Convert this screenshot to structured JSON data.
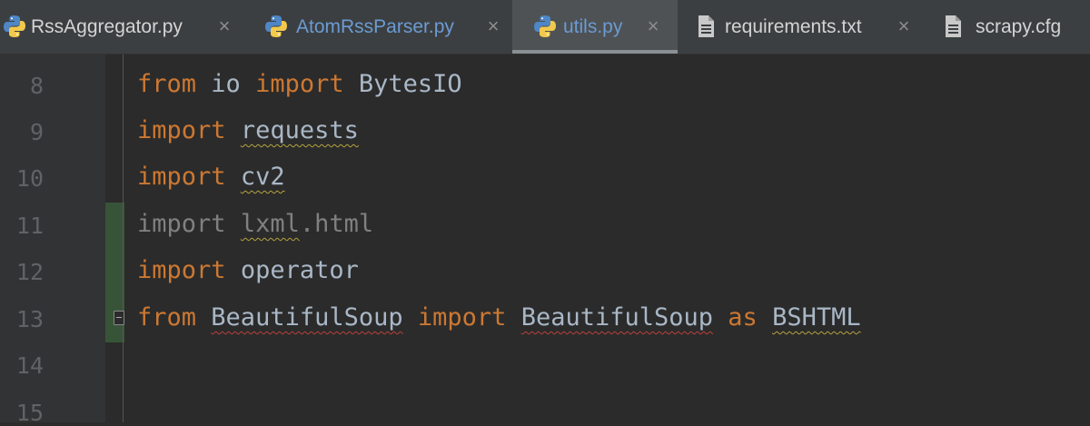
{
  "tabs": [
    {
      "label": "RssAggregator.py",
      "icon": "python-file-icon",
      "active": false
    },
    {
      "label": "AtomRssParser.py",
      "icon": "python-file-icon",
      "active": false,
      "modified": true
    },
    {
      "label": "utils.py",
      "icon": "python-file-icon",
      "active": true,
      "modified": true
    },
    {
      "label": "requirements.txt",
      "icon": "text-file-icon",
      "active": false
    },
    {
      "label": "scrapy.cfg",
      "icon": "text-file-icon",
      "active": false
    }
  ],
  "close_glyph": "×",
  "line_numbers": [
    "8",
    "9",
    "10",
    "11",
    "12",
    "13",
    "14",
    "15"
  ],
  "code": {
    "line8": {
      "kw1": "from",
      "mod": "io",
      "kw2": "import",
      "name": "BytesIO"
    },
    "line9": {
      "kw": "import",
      "mod": "requests"
    },
    "line10": {
      "kw": "import",
      "mod": "cv2"
    },
    "line11": {
      "kw": "import",
      "mod": "lxml",
      "rest": ".html"
    },
    "line12": {
      "kw": "import",
      "mod": "operator"
    },
    "line13": {
      "kw1": "from",
      "mod": "BeautifulSoup",
      "kw2": "import",
      "name": "BeautifulSoup",
      "kw3": "as",
      "alias": "BSHTML"
    }
  },
  "colors": {
    "keyword": "#cc7832",
    "identifier": "#a9b7c6",
    "unused": "#808080",
    "modified_tab": "#6b9bd3",
    "warning_underline": "#b7a23f",
    "error_underline": "#bc3f3c"
  }
}
